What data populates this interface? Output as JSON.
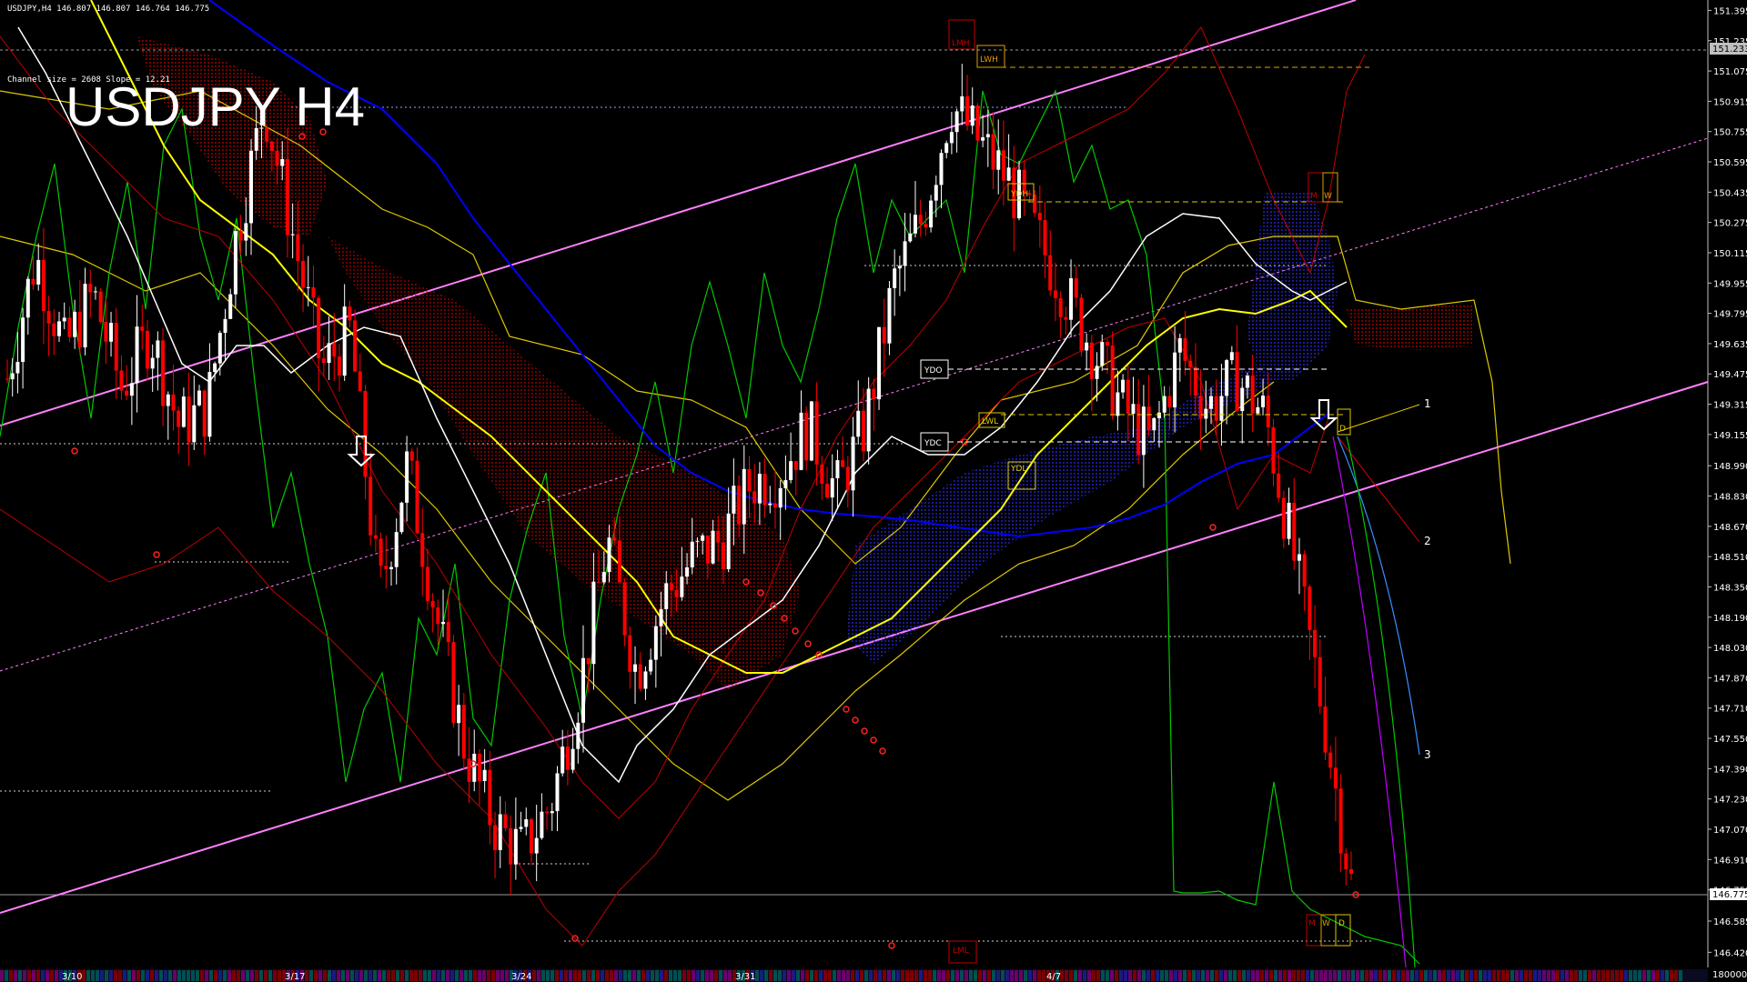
{
  "header": {
    "info": "USDJPY,H4  146.807 146.807 146.764 146.775",
    "channel": "Channel size = 2608 Slope = 12.21",
    "title": "USDJPY H4"
  },
  "chart_data": {
    "type": "candlestick",
    "symbol": "USDJPY",
    "timeframe": "H4",
    "ylim": [
      146.34,
      151.45
    ],
    "yticks": [
      "151.395",
      "151.235",
      "151.075",
      "150.915",
      "150.755",
      "150.595",
      "150.435",
      "150.275",
      "150.115",
      "149.955",
      "149.795",
      "149.635",
      "149.475",
      "149.315",
      "149.155",
      "148.990",
      "148.830",
      "148.670",
      "148.510",
      "148.350",
      "148.190",
      "148.030",
      "147.870",
      "147.710",
      "147.550",
      "147.390",
      "147.230",
      "147.070",
      "146.910",
      "146.750",
      "146.585",
      "146.420"
    ],
    "price_labels": [
      {
        "text": "151.233",
        "value": 151.233
      },
      {
        "text": "146.775",
        "value": 146.775
      }
    ],
    "volume_label": "180000",
    "date_labels": [
      "3/10",
      "3/17",
      "3/24",
      "3/31",
      "4/7"
    ],
    "close_path": [
      149.45,
      150.1,
      149.6,
      149.9,
      149.4,
      149.7,
      149.2,
      149.3,
      150.2,
      150.9,
      150.2,
      149.5,
      149.7,
      148.3,
      149.0,
      148.2,
      147.5,
      147.1,
      146.95,
      147.2,
      147.8,
      148.6,
      147.9,
      148.3,
      148.5,
      148.6,
      148.9,
      148.95,
      149.2,
      148.85,
      149.2,
      149.95,
      150.3,
      150.9,
      150.7,
      150.5,
      150.2,
      149.9,
      149.6,
      149.3,
      149.1,
      149.6,
      149.3,
      149.45,
      149.25,
      148.5,
      147.7,
      146.78
    ],
    "projection_labels": [
      "1",
      "2",
      "3"
    ],
    "level_tags": {
      "lmh": "LMH",
      "lwh": "LWH",
      "ydh": "YDH",
      "ydo": "YDO",
      "ydc": "YDC",
      "lwl": "LWL",
      "ydl": "YDL",
      "lml": "LML",
      "m": "M",
      "w": "W",
      "d": "D"
    },
    "colors": {
      "bull": "#ffffff",
      "bear": "#ff0000",
      "channel": "#ff80ff",
      "ma_blue": "#0000ff",
      "ma_yellow": "#ffff00",
      "ma_white": "#ffffff",
      "osc_green": "#00c800",
      "cloud_red": "#c00000",
      "cloud_blue": "#1a1a99"
    }
  }
}
